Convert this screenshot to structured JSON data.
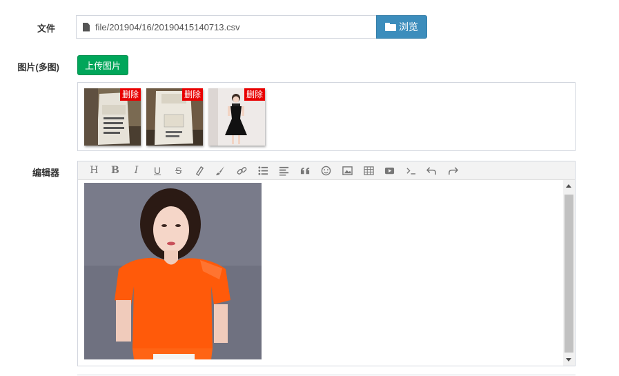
{
  "form": {
    "file_label": "文件",
    "file_value": "file/201904/16/20190415140713.csv",
    "browse_label": "浏览",
    "images_label": "图片(多图)",
    "upload_label": "上传图片",
    "editor_label": "编辑器"
  },
  "thumbnails": [
    {
      "delete_label": "删除",
      "icon": "product-photo-milk-box-1"
    },
    {
      "delete_label": "删除",
      "icon": "product-photo-milk-box-2"
    },
    {
      "delete_label": "删除",
      "icon": "product-photo-woman-black-dress"
    }
  ],
  "editor": {
    "toolbar": [
      "heading-icon",
      "bold-icon",
      "italic-icon",
      "underline-icon",
      "strikethrough-icon",
      "highlight-icon",
      "brush-icon",
      "link-icon",
      "list-icon",
      "align-icon",
      "quote-icon",
      "emoji-icon",
      "image-icon",
      "table-icon",
      "video-icon",
      "code-icon",
      "undo-icon",
      "redo-icon"
    ],
    "content_image": "woman-orange-blouse-photo"
  },
  "colors": {
    "browse_bg": "#3c8dbc",
    "upload_bg": "#00a65a",
    "delete_bg": "#e80000",
    "blouse": "#ff5a0a"
  }
}
